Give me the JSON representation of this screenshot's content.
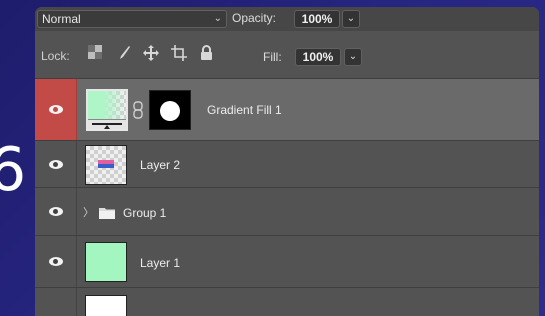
{
  "background": {
    "glyph": "6"
  },
  "toolbar": {
    "blend_mode": "Normal",
    "blend_caret": "⌄",
    "opacity_label": "Opacity:",
    "opacity_value": "100%",
    "opacity_caret": "⌄",
    "lock_label": "Lock:",
    "fill_label": "Fill:",
    "fill_value": "100%",
    "fill_caret": "⌄"
  },
  "layers": [
    {
      "name": "Gradient Fill 1",
      "selected": true,
      "visible": true,
      "type": "gradient-fill-with-mask"
    },
    {
      "name": "Layer 2",
      "selected": false,
      "visible": true,
      "type": "pixel"
    },
    {
      "name": "Group 1",
      "selected": false,
      "visible": true,
      "type": "group",
      "expand_glyph": "〉"
    },
    {
      "name": "Layer 1",
      "selected": false,
      "visible": true,
      "type": "pixel"
    }
  ],
  "colors": {
    "panel": "#535353",
    "selected_row": "#6a6a6a",
    "visibility_active": "#c24a47",
    "gradient_start": "#aef5c8",
    "layer1_fill": "#a3f6bf"
  }
}
